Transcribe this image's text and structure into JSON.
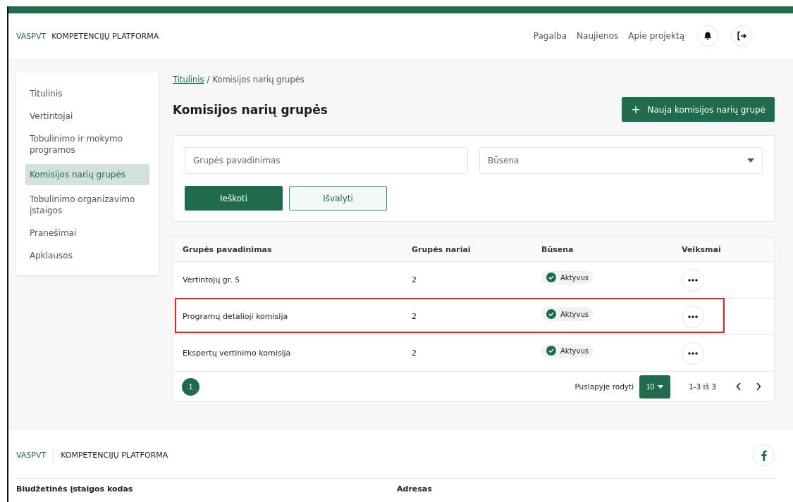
{
  "header": {
    "brand": "VASPVT",
    "title": "KOMPETENCIJŲ PLATFORMA",
    "nav": [
      "Pagalba",
      "Naujienos",
      "Apie projektą"
    ]
  },
  "sidebar": {
    "items": [
      {
        "label": "Titulinis",
        "selected": false
      },
      {
        "label": "Vertintojai",
        "selected": false
      },
      {
        "label": "Tobulinimo ir mokymo programos",
        "selected": false
      },
      {
        "label": "Komisijos narių grupės",
        "selected": true
      },
      {
        "label": "Tobulinimo organizavimo įstaigos",
        "selected": false
      },
      {
        "label": "Pranešimai",
        "selected": false
      },
      {
        "label": "Apklausos",
        "selected": false
      }
    ]
  },
  "breadcrumb": {
    "link": "Titulinis",
    "separator": "/",
    "current": "Komisijos narių grupės"
  },
  "page_title": "Komisijos narių grupės",
  "new_button": {
    "icon": "+",
    "label": "Nauja komisijos narių grupė"
  },
  "filters": {
    "name_placeholder": "Grupės pavadinimas",
    "status_placeholder": "Būsena",
    "search_button": "Ieškoti",
    "clear_button": "Išvalyti"
  },
  "table": {
    "columns": [
      "Grupės pavadinimas",
      "Grupės nariai",
      "Būsena",
      "Veiksmai"
    ],
    "rows": [
      {
        "name": "Vertintojų gr. 5",
        "members": "2",
        "status": "Aktyvus",
        "highlighted": false
      },
      {
        "name": "Programų detalioji komisija",
        "members": "2",
        "status": "Aktyvus",
        "highlighted": true
      },
      {
        "name": "Ekspertų vertinimo komisija",
        "members": "2",
        "status": "Aktyvus",
        "highlighted": false
      }
    ],
    "pagination": {
      "pages": [
        {
          "label": "1",
          "selected": true
        }
      ],
      "per_page_label": "Puslapyje rodyti",
      "per_page": "10",
      "range": "1-3 iš 3"
    }
  },
  "footer": {
    "brand": "VASPVT",
    "title": "KOMPETENCIJŲ PLATFORMA",
    "labels": [
      "Biudžetinės įstaigos kodas",
      "Adresas"
    ]
  }
}
